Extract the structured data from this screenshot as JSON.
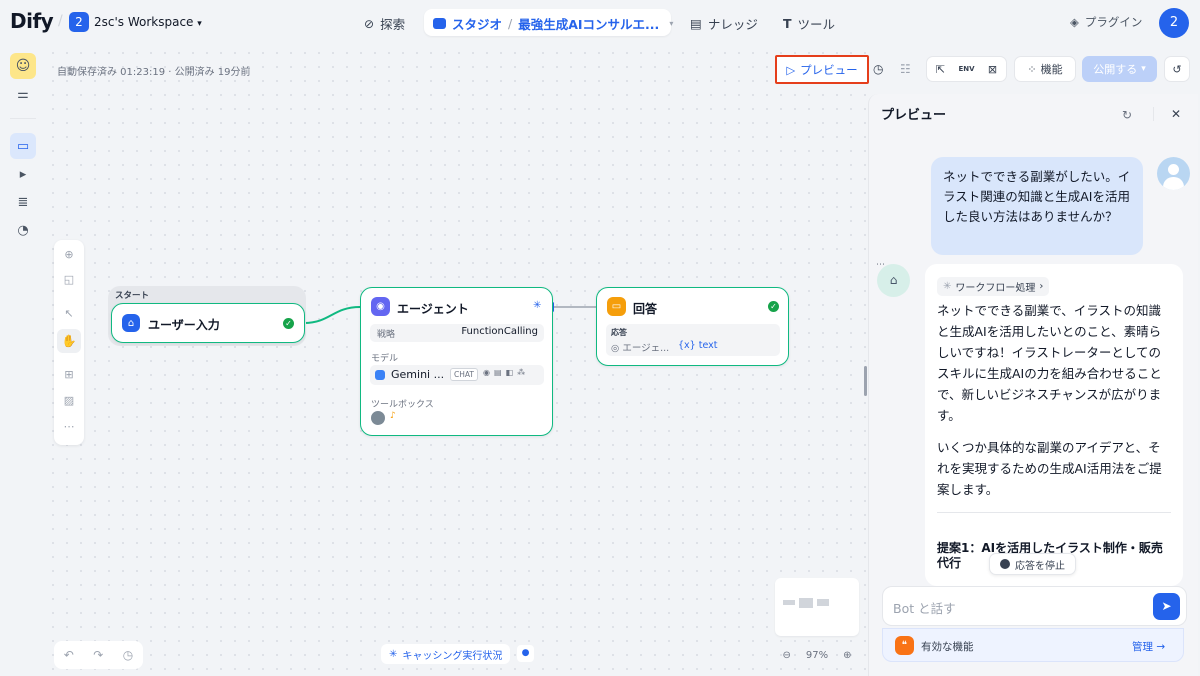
{
  "topbar": {
    "logo": "Dify",
    "workspace_badge": "2",
    "workspace_name": "2sc's Workspace",
    "nav": {
      "explore": "探索",
      "studio": "スタジオ",
      "app_name": "最強生成AIコンサルエ...",
      "knowledge": "ナレッジ",
      "tools": "ツール",
      "plugins": "プラグイン"
    },
    "avatar": "2"
  },
  "canvas": {
    "autosave": "自動保存済み 01:23:19 · 公開済み 19分前",
    "toolbar": {
      "preview": "プレビュー",
      "env": "ENV",
      "features": "機能",
      "publish": "公開する"
    },
    "start_label": "スタート",
    "user_input_node": {
      "title": "ユーザー入力"
    },
    "agent_node": {
      "title": "エージェント",
      "strategy_label": "戦略",
      "strategy_value": "FunctionCalling",
      "model_label": "モデル",
      "model_name": "Gemini ...",
      "model_tag": "CHAT",
      "toolbox_label": "ツールボックス"
    },
    "answer_node": {
      "title": "回答",
      "response_label": "応答",
      "response_source": "エージェ...",
      "response_var": "{x} text"
    },
    "bottom": {
      "caching_status": "キャッシング実行状況",
      "zoom": "97%"
    }
  },
  "preview": {
    "title": "プレビュー",
    "user_message": "ネットでできる副業がしたい。イラスト関連の知識と生成AIを活用した良い方法はありませんか？",
    "workflow_process": "ワークフロー処理",
    "bot_para1": "ネットでできる副業で、イラストの知識と生成AIを活用したいとのこと、素晴らしいですね！イラストレーターとしてのスキルに生成AIの力を組み合わせることで、新しいビジネスチャンスが広がります。",
    "bot_para2": "いくつか具体的な副業のアイデアと、それを実現するための生成AI活用法をご提案します。",
    "bot_heading": "提案1：AIを活用したイラスト制作・販売代行",
    "stop_button": "応答を停止",
    "input_placeholder": "Bot と話す",
    "features_label": "有効な機能",
    "manage_label": "管理 →"
  },
  "colors": {
    "accent": "#2563eb",
    "node_border": "#10b981",
    "highlight_box": "#e53e1b"
  }
}
